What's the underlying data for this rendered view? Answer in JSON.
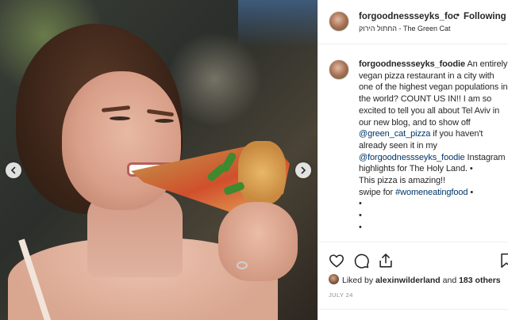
{
  "post": {
    "username": "forgoodnessseyks_foodie",
    "header_username": "forgoodnessseyks_fooc",
    "follow_separator": "•",
    "follow_label": "Following",
    "location": "החתול הירוק - The Green Cat"
  },
  "caption": {
    "username": "forgoodnessseyks_foodie",
    "part1": " An entirely vegan pizza restaurant in a city with one of the highest vegan populations in the world? COUNT US IN!! I am so excited to tell you all about Tel Aviv in our new blog, and to show off ",
    "mention1": "@green_cat_pizza",
    "part2": " if you haven't already seen it in my ",
    "mention2": "@forgoodnessseyks_foodie",
    "part3": " Instagram highlights for The Holy Land. •",
    "line_amazing": "This pizza is amazing!!",
    "line_swipe_prefix": "swipe for ",
    "hashtag": "#womeneatingfood",
    "line_swipe_suffix": " •",
    "dots": [
      "•",
      "•",
      "•",
      "•"
    ]
  },
  "likes": {
    "prefix": "Liked by ",
    "user": "alexinwilderland",
    "middle": " and ",
    "count": "183 others"
  },
  "date": "JULY 24",
  "icons": {
    "prev": "chevron-left-icon",
    "next": "chevron-right-icon",
    "like": "heart-icon",
    "comment": "comment-icon",
    "share": "share-icon",
    "save": "bookmark-icon"
  },
  "colors": {
    "link": "#003569",
    "text": "#262626",
    "muted": "#8e8e8e",
    "border": "#efefef"
  }
}
